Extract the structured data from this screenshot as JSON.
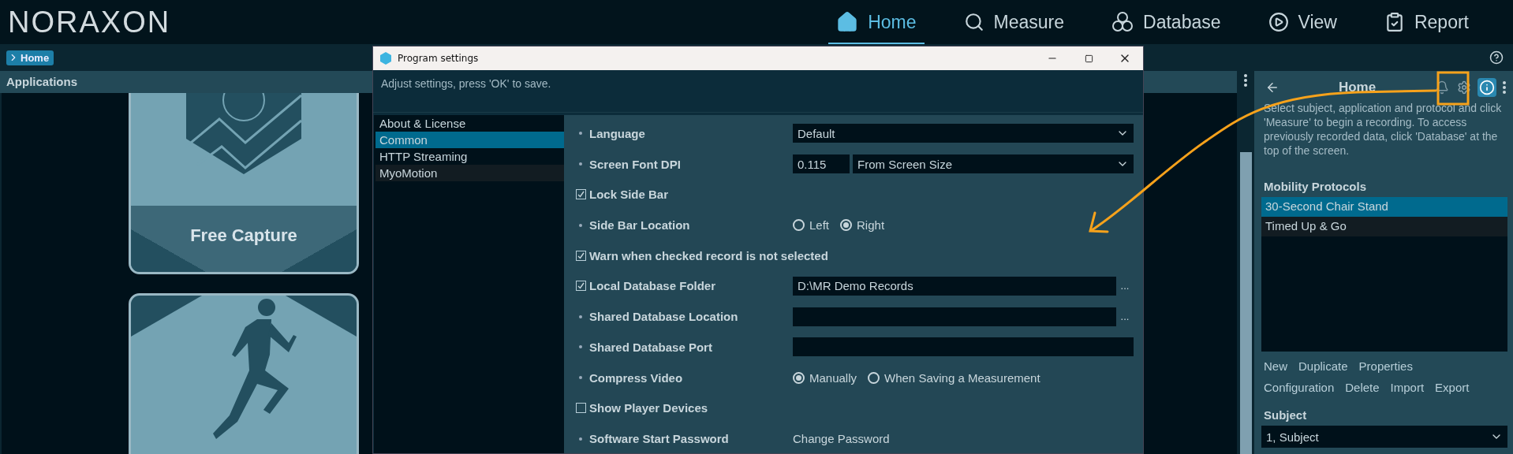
{
  "brand": {
    "logo": "NORAXON"
  },
  "nav": [
    {
      "label": "Home",
      "selected": true
    },
    {
      "label": "Measure",
      "selected": false
    },
    {
      "label": "Database",
      "selected": false
    },
    {
      "label": "View",
      "selected": false
    },
    {
      "label": "Report",
      "selected": false
    }
  ],
  "breadcrumb": {
    "label": "Home"
  },
  "applications": {
    "title": "Applications",
    "cards": [
      {
        "kind": "capture",
        "label": "Free Capture"
      },
      {
        "kind": "runner"
      }
    ]
  },
  "dialog": {
    "title": "Program settings",
    "subtitle": "Adjust settings, press 'OK' to save.",
    "categories": [
      {
        "label": "About & License",
        "selected": false
      },
      {
        "label": "Common",
        "selected": true
      },
      {
        "label": "HTTP Streaming",
        "selected": false
      },
      {
        "label": "MyoMotion",
        "selected": false
      }
    ],
    "settings": [
      {
        "kind": "bullet",
        "label": "Language",
        "control": {
          "kind": "select",
          "value": "Default"
        }
      },
      {
        "kind": "bullet",
        "label": "Screen Font DPI",
        "control": {
          "kind": "dpi",
          "value": "0.115",
          "mode": "From Screen Size"
        }
      },
      {
        "kind": "checkbox",
        "checked": true,
        "label": "Lock Side Bar"
      },
      {
        "kind": "bullet",
        "label": "Side Bar Location",
        "control": {
          "kind": "radio",
          "options": [
            {
              "label": "Left",
              "selected": false
            },
            {
              "label": "Right",
              "selected": true
            }
          ]
        }
      },
      {
        "kind": "checkbox",
        "checked": true,
        "label": "Warn when checked record is not selected"
      },
      {
        "kind": "checkbox",
        "checked": true,
        "label": "Local Database Folder",
        "control": {
          "kind": "path",
          "value": "D:\\MR Demo Records",
          "browse": "..."
        }
      },
      {
        "kind": "bullet",
        "label": "Shared Database Location",
        "control": {
          "kind": "path",
          "browse": "..."
        }
      },
      {
        "kind": "bullet",
        "label": "Shared Database Port",
        "control": {
          "kind": "text"
        }
      },
      {
        "kind": "bullet",
        "label": "Compress Video",
        "control": {
          "kind": "radio",
          "options": [
            {
              "label": "Manually",
              "selected": true
            },
            {
              "label": "When Saving a Measurement",
              "selected": false
            }
          ]
        }
      },
      {
        "kind": "checkbox",
        "checked": false,
        "label": "Show Player Devices"
      },
      {
        "kind": "bullet",
        "label": "Software Start Password",
        "control": {
          "kind": "link",
          "label": "Change Password"
        }
      }
    ]
  },
  "sidebar": {
    "title": "Home",
    "description": "Select subject, application and protocol and click 'Measure' to begin a recording. To access previously recorded data, click 'Database' at the top of the screen.",
    "protocols": {
      "title": "Mobility Protocols",
      "items": [
        {
          "label": "30-Second Chair Stand",
          "selected": true
        },
        {
          "label": "Timed Up & Go",
          "selected": false
        }
      ]
    },
    "actions": [
      [
        "New",
        "Duplicate",
        "Properties"
      ],
      [
        "Configuration",
        "Delete",
        "Import",
        "Export"
      ]
    ],
    "subject": {
      "label": "Subject",
      "value": "1, Subject"
    }
  }
}
